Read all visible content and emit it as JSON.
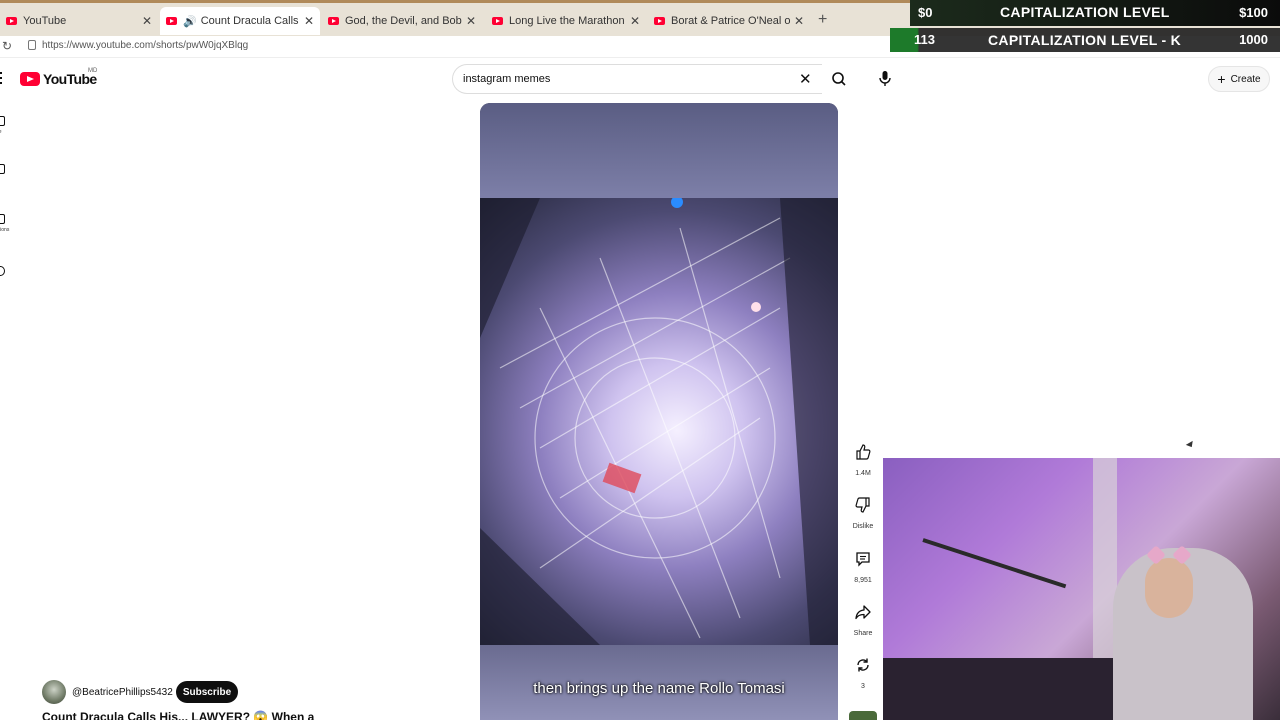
{
  "browser": {
    "tabs": [
      {
        "title": "YouTube",
        "active": false
      },
      {
        "title": "Count Dracula Calls His... LAW",
        "active": true
      },
      {
        "title": "God, the Devil, and Bob. - YouTub",
        "active": false
      },
      {
        "title": "Long Live the Marathon Part 3 | Fu",
        "active": false
      },
      {
        "title": "Borat & Patrice O'Neal on O&A (F",
        "active": false
      }
    ],
    "url": "https://www.youtube.com/shorts/pwW0jqXBlqg"
  },
  "overlay": {
    "row1": {
      "left": "$0",
      "label": "CAPITALIZATION LEVEL",
      "right": "$100"
    },
    "row2": {
      "left": "113",
      "label": "CAPITALIZATION LEVEL - K",
      "right": "1000"
    }
  },
  "youtube": {
    "logo_text": "YouTube",
    "country_code": "MD",
    "search_query": "instagram memes",
    "create_label": "Create",
    "rail": [
      {
        "label": "ne",
        "icon": "home-icon"
      },
      {
        "label": "ts",
        "icon": "shorts-icon"
      },
      {
        "label": "ptions",
        "icon": "subscriptions-icon"
      },
      {
        "label": "u",
        "icon": "you-icon"
      }
    ]
  },
  "short": {
    "caption": "then brings up the name Rollo Tomasi",
    "channel_handle": "@BeatricePhillips5432",
    "subscribe_label": "Subscribe",
    "title": "Count Dracula Calls His... LAWYER? 😱 When a"
  },
  "actions": {
    "like_count": "1.4M",
    "dislike_label": "Dislike",
    "comment_count": "8,951",
    "share_label": "Share",
    "remix_count": "3"
  }
}
